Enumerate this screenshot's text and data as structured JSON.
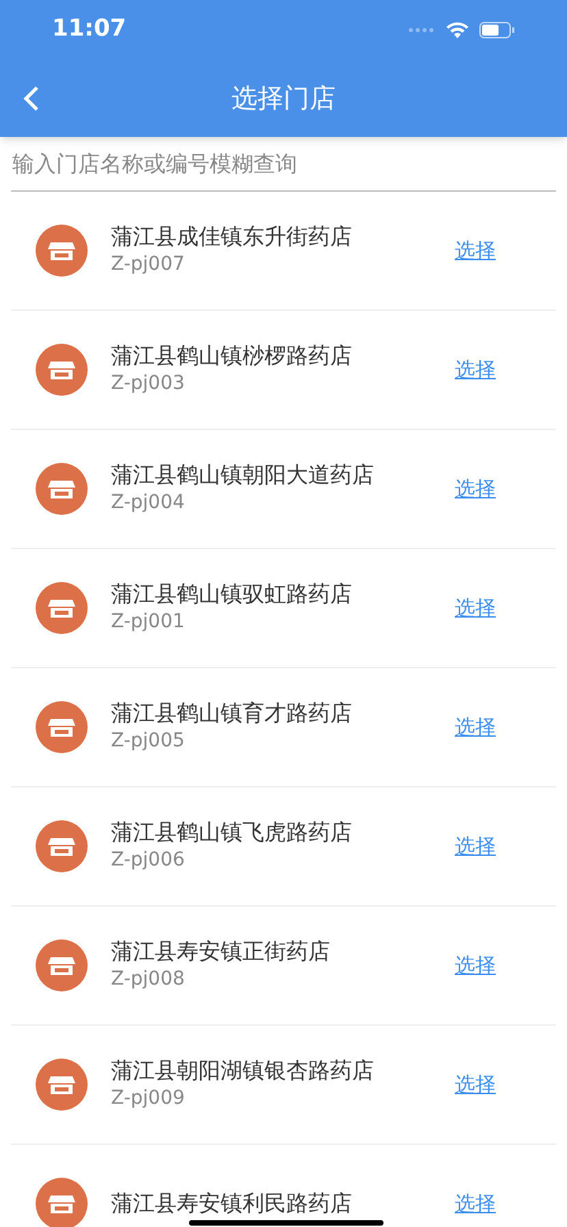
{
  "status_bar": {
    "time": "11:07"
  },
  "nav": {
    "title": "选择门店"
  },
  "search": {
    "placeholder": "输入门店名称或编号模糊查询"
  },
  "stores": [
    {
      "name": "蒲江县成佳镇东升街药店",
      "code": "Z-pj007",
      "action": "选择"
    },
    {
      "name": "蒲江县鹤山镇桫椤路药店",
      "code": "Z-pj003",
      "action": "选择"
    },
    {
      "name": "蒲江县鹤山镇朝阳大道药店",
      "code": "Z-pj004",
      "action": "选择"
    },
    {
      "name": "蒲江县鹤山镇驭虹路药店",
      "code": "Z-pj001",
      "action": "选择"
    },
    {
      "name": "蒲江县鹤山镇育才路药店",
      "code": "Z-pj005",
      "action": "选择"
    },
    {
      "name": "蒲江县鹤山镇飞虎路药店",
      "code": "Z-pj006",
      "action": "选择"
    },
    {
      "name": "蒲江县寿安镇正街药店",
      "code": "Z-pj008",
      "action": "选择"
    },
    {
      "name": "蒲江县朝阳湖镇银杏路药店",
      "code": "Z-pj009",
      "action": "选择"
    },
    {
      "name": "蒲江县寿安镇利民路药店",
      "action": "选择"
    }
  ]
}
